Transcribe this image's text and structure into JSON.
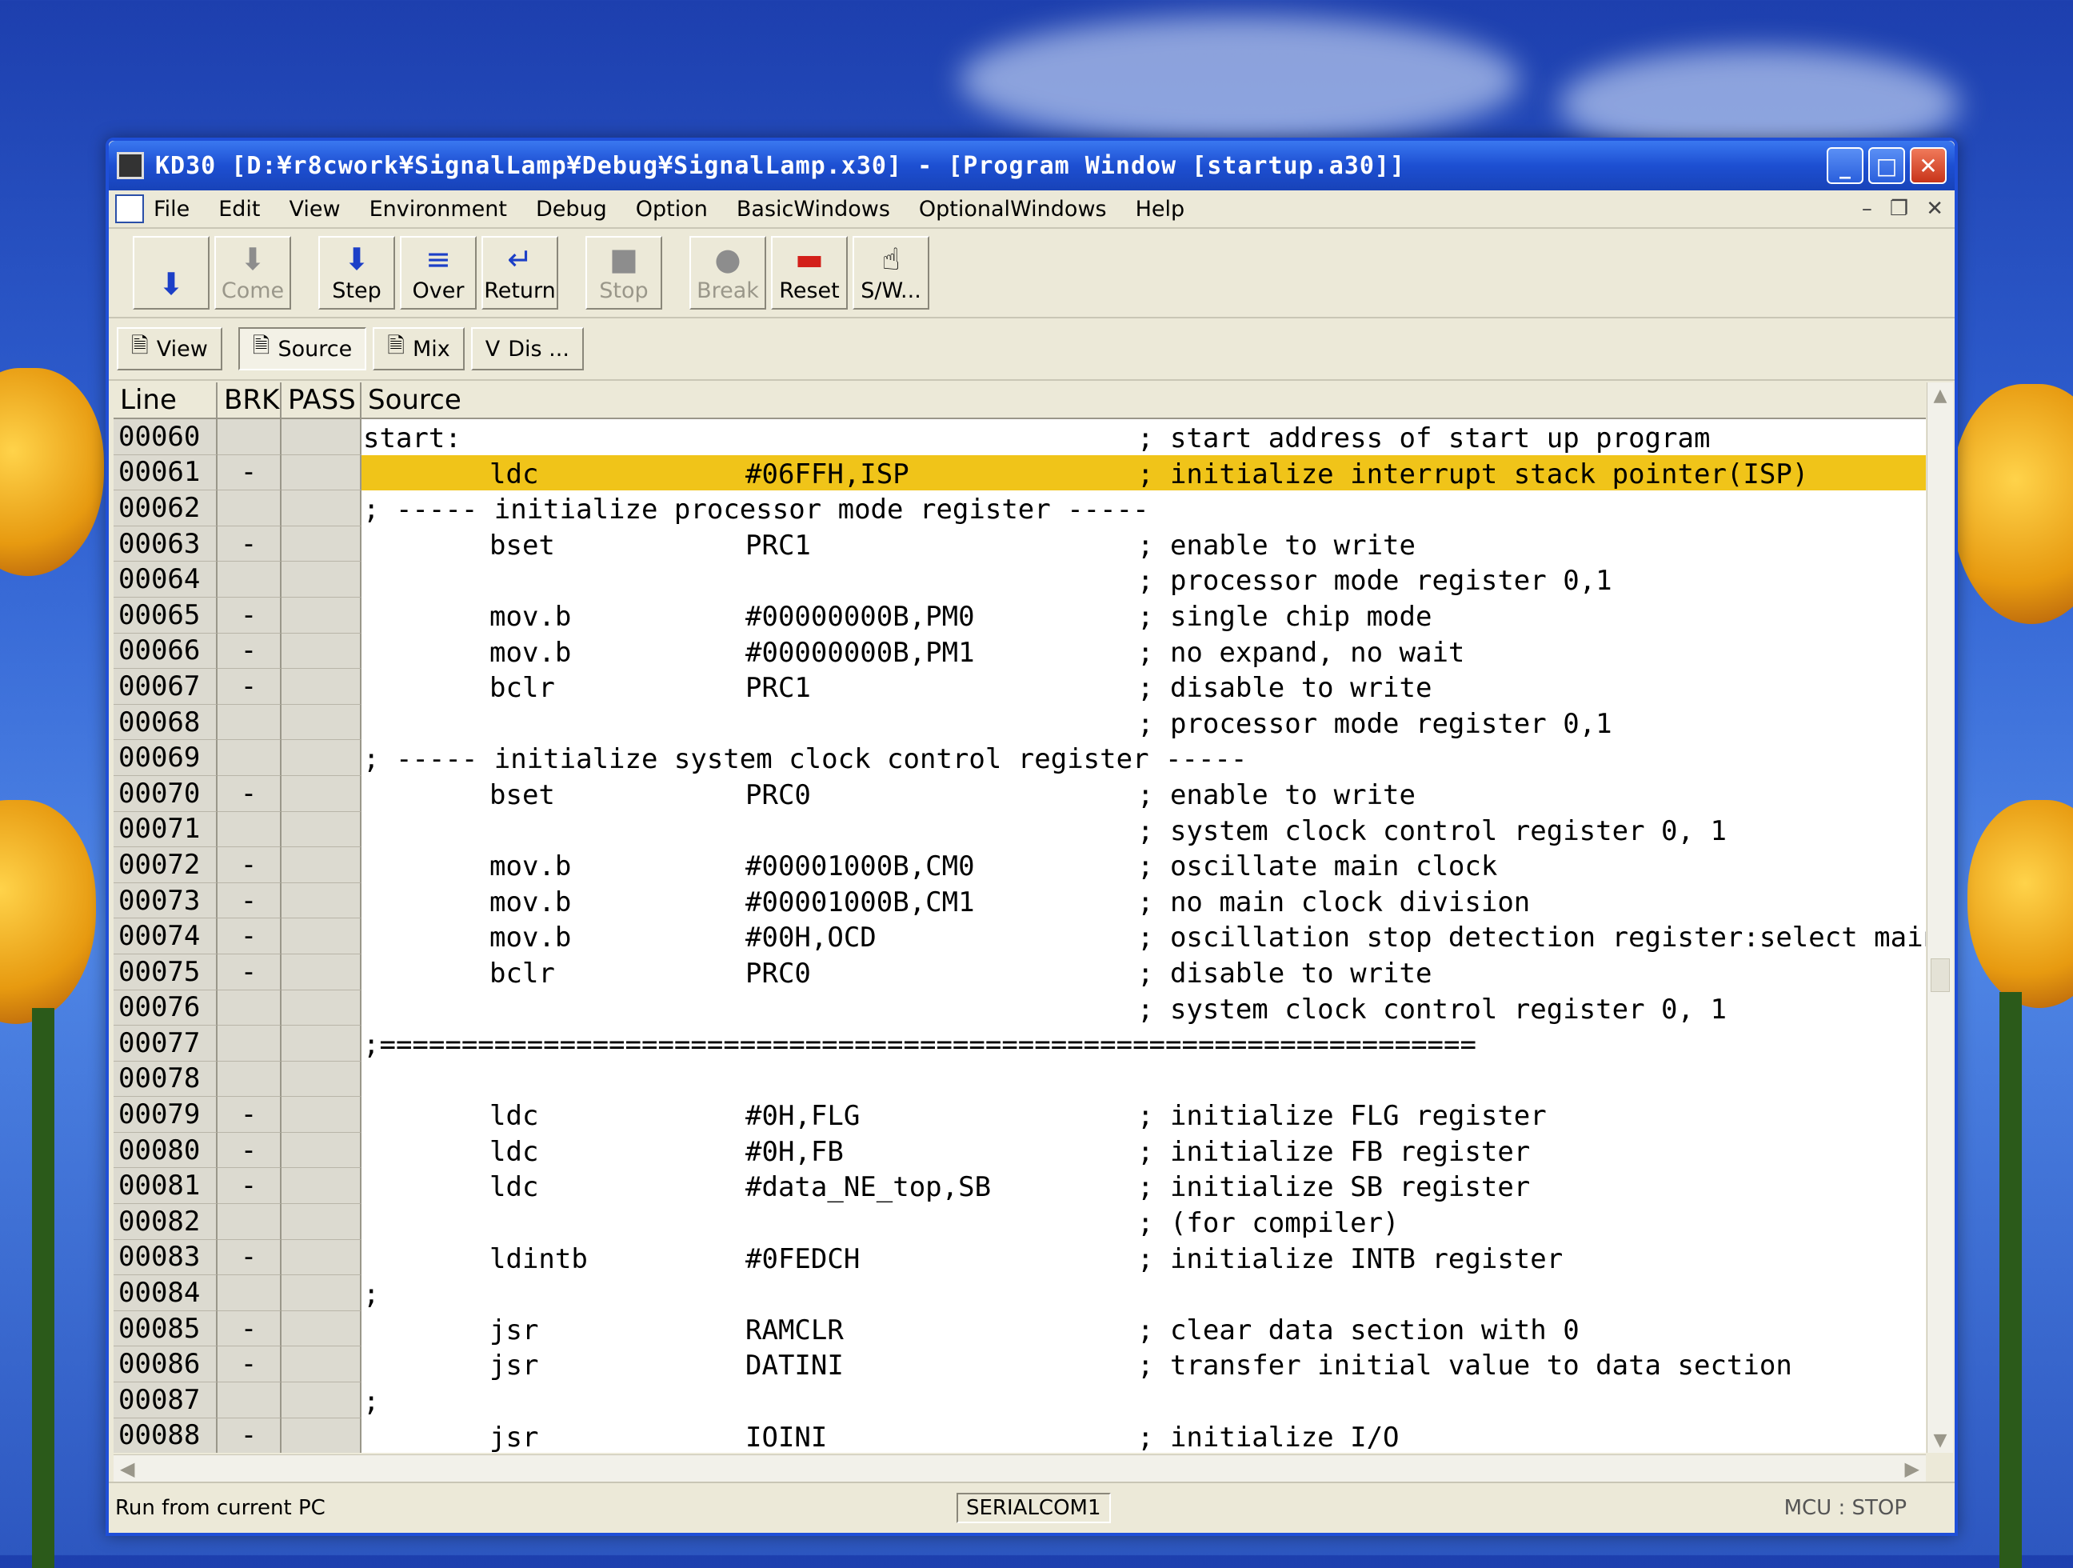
{
  "window": {
    "title": "KD30 [D:¥r8cwork¥SignalLamp¥Debug¥SignalLamp.x30] - [Program Window [startup.a30]]"
  },
  "menu": [
    "File",
    "Edit",
    "View",
    "Environment",
    "Debug",
    "Option",
    "BasicWindows",
    "OptionalWindows",
    "Help"
  ],
  "toolbar": {
    "go_label": "",
    "come_label": "Come",
    "step_label": "Step",
    "over_label": "Over",
    "return_label": "Return",
    "stop_label": "Stop",
    "break_label": "Break",
    "reset_label": "Reset",
    "sw_label": "S/W..."
  },
  "viewbar": {
    "view_label": "View",
    "source_label": "Source",
    "mix_label": "Mix",
    "dis_label": "Dis ..."
  },
  "grid": {
    "headers": {
      "line": "Line",
      "brk": "BRK",
      "pass": "PASS",
      "source": "Source"
    },
    "rows": [
      {
        "line": "00060",
        "brk": "",
        "label": "start:",
        "op": "",
        "arg": "",
        "cmt": "; start address of start up program"
      },
      {
        "line": "00061",
        "brk": "-",
        "label": "",
        "op": "ldc",
        "arg": "#06FFH,ISP",
        "cmt": "; initialize interrupt stack pointer(ISP)",
        "current": true
      },
      {
        "line": "00062",
        "brk": "",
        "label": "; ----- initialize processor mode register -----",
        "op": "",
        "arg": "",
        "cmt": ""
      },
      {
        "line": "00063",
        "brk": "-",
        "label": "",
        "op": "bset",
        "arg": "PRC1",
        "cmt": "; enable to write"
      },
      {
        "line": "00064",
        "brk": "",
        "label": "",
        "op": "",
        "arg": "",
        "cmt": "; processor mode register 0,1"
      },
      {
        "line": "00065",
        "brk": "-",
        "label": "",
        "op": "mov.b",
        "arg": "#00000000B,PM0",
        "cmt": "; single chip mode"
      },
      {
        "line": "00066",
        "brk": "-",
        "label": "",
        "op": "mov.b",
        "arg": "#00000000B,PM1",
        "cmt": "; no expand, no wait"
      },
      {
        "line": "00067",
        "brk": "-",
        "label": "",
        "op": "bclr",
        "arg": "PRC1",
        "cmt": "; disable to write"
      },
      {
        "line": "00068",
        "brk": "",
        "label": "",
        "op": "",
        "arg": "",
        "cmt": "; processor mode register 0,1"
      },
      {
        "line": "00069",
        "brk": "",
        "label": "; ----- initialize system clock control register -----",
        "op": "",
        "arg": "",
        "cmt": ""
      },
      {
        "line": "00070",
        "brk": "-",
        "label": "",
        "op": "bset",
        "arg": "PRC0",
        "cmt": "; enable to write"
      },
      {
        "line": "00071",
        "brk": "",
        "label": "",
        "op": "",
        "arg": "",
        "cmt": "; system clock control register 0, 1"
      },
      {
        "line": "00072",
        "brk": "-",
        "label": "",
        "op": "mov.b",
        "arg": "#00001000B,CM0",
        "cmt": "; oscillate main clock"
      },
      {
        "line": "00073",
        "brk": "-",
        "label": "",
        "op": "mov.b",
        "arg": "#00001000B,CM1",
        "cmt": "; no main clock division"
      },
      {
        "line": "00074",
        "brk": "-",
        "label": "",
        "op": "mov.b",
        "arg": "#00H,OCD",
        "cmt": "; oscillation stop detection register:select main c"
      },
      {
        "line": "00075",
        "brk": "-",
        "label": "",
        "op": "bclr",
        "arg": "PRC0",
        "cmt": "; disable to write"
      },
      {
        "line": "00076",
        "brk": "",
        "label": "",
        "op": "",
        "arg": "",
        "cmt": "; system clock control register 0, 1"
      },
      {
        "line": "00077",
        "brk": "",
        "label": ";===================================================================",
        "op": "",
        "arg": "",
        "cmt": ""
      },
      {
        "line": "00078",
        "brk": "",
        "label": "",
        "op": "",
        "arg": "",
        "cmt": ""
      },
      {
        "line": "00079",
        "brk": "-",
        "label": "",
        "op": "ldc",
        "arg": "#0H,FLG",
        "cmt": "; initialize FLG register"
      },
      {
        "line": "00080",
        "brk": "-",
        "label": "",
        "op": "ldc",
        "arg": "#0H,FB",
        "cmt": "; initialize FB register"
      },
      {
        "line": "00081",
        "brk": "-",
        "label": "",
        "op": "ldc",
        "arg": "#data_NE_top,SB",
        "cmt": "; initialize SB register"
      },
      {
        "line": "00082",
        "brk": "",
        "label": "",
        "op": "",
        "arg": "",
        "cmt": "; (for compiler)"
      },
      {
        "line": "00083",
        "brk": "-",
        "label": "",
        "op": "ldintb",
        "arg": "#0FEDCH",
        "cmt": "; initialize INTB register"
      },
      {
        "line": "00084",
        "brk": "",
        "label": ";",
        "op": "",
        "arg": "",
        "cmt": ""
      },
      {
        "line": "00085",
        "brk": "-",
        "label": "",
        "op": "jsr",
        "arg": "RAMCLR",
        "cmt": "; clear data section with 0"
      },
      {
        "line": "00086",
        "brk": "-",
        "label": "",
        "op": "jsr",
        "arg": "DATINI",
        "cmt": "; transfer initial value to data section"
      },
      {
        "line": "00087",
        "brk": "",
        "label": ";",
        "op": "",
        "arg": "",
        "cmt": ""
      },
      {
        "line": "00088",
        "brk": "-",
        "label": "",
        "op": "jsr",
        "arg": "IOINI",
        "cmt": "; initialize I/O"
      }
    ]
  },
  "status": {
    "message": "Run from current PC",
    "port": "SERIALCOM1",
    "mcu": "MCU : STOP"
  },
  "colors": {
    "titlebar": "#1d4fd2",
    "current_line_highlight": "#f0c419",
    "window_face": "#ece9d8"
  }
}
